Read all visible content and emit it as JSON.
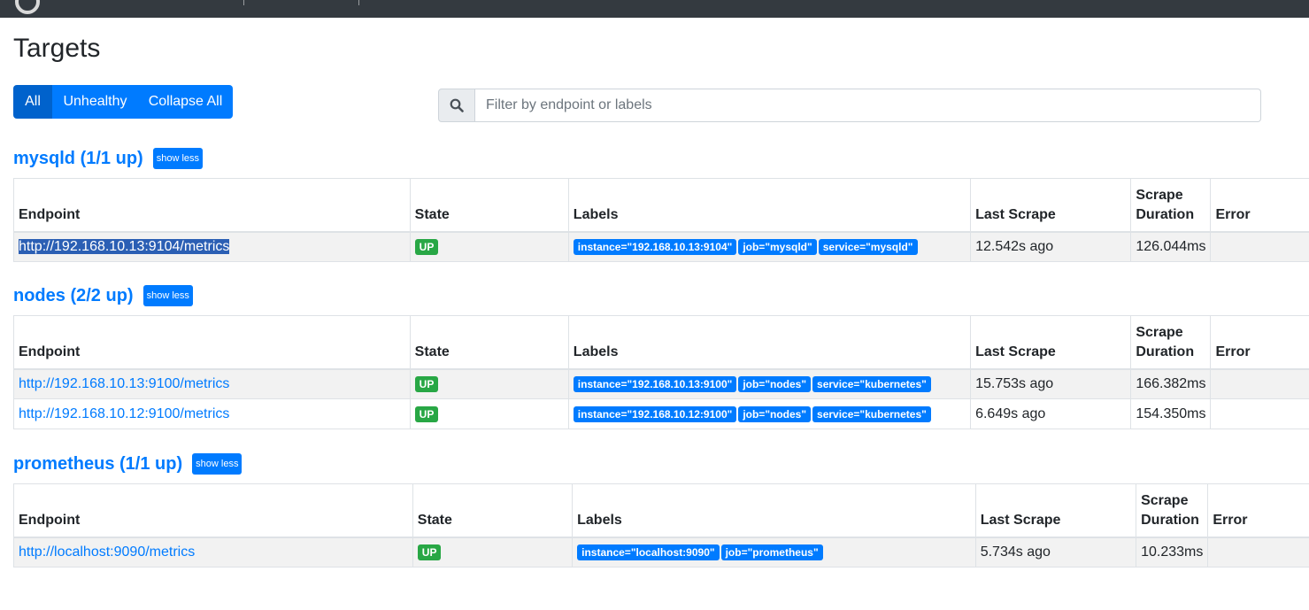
{
  "page_title": "Targets",
  "filter_buttons": [
    {
      "label": "All",
      "active": true
    },
    {
      "label": "Unhealthy",
      "active": false
    },
    {
      "label": "Collapse All",
      "active": false
    }
  ],
  "search": {
    "placeholder": "Filter by endpoint or labels",
    "icon": "search-icon"
  },
  "columns": [
    "Endpoint",
    "State",
    "Labels",
    "Last Scrape",
    "Scrape Duration",
    "Error"
  ],
  "pools": [
    {
      "title": "mysqld (1/1 up)",
      "toggle_label": "show less",
      "targets": [
        {
          "endpoint": "http://192.168.10.13:9104/metrics",
          "state": "UP",
          "labels": [
            "instance=\"192.168.10.13:9104\"",
            "job=\"mysqld\"",
            "service=\"mysqld\""
          ],
          "last_scrape": "12.542s ago",
          "duration": "126.044ms",
          "error": ""
        }
      ]
    },
    {
      "title": "nodes (2/2 up)",
      "toggle_label": "show less",
      "targets": [
        {
          "endpoint": "http://192.168.10.13:9100/metrics",
          "state": "UP",
          "labels": [
            "instance=\"192.168.10.13:9100\"",
            "job=\"nodes\"",
            "service=\"kubernetes\""
          ],
          "last_scrape": "15.753s ago",
          "duration": "166.382ms",
          "error": ""
        },
        {
          "endpoint": "http://192.168.10.12:9100/metrics",
          "state": "UP",
          "labels": [
            "instance=\"192.168.10.12:9100\"",
            "job=\"nodes\"",
            "service=\"kubernetes\""
          ],
          "last_scrape": "6.649s ago",
          "duration": "154.350ms",
          "error": ""
        }
      ]
    },
    {
      "title": "prometheus (1/1 up)",
      "toggle_label": "show less",
      "targets": [
        {
          "endpoint": "http://localhost:9090/metrics",
          "state": "UP",
          "labels": [
            "instance=\"localhost:9090\"",
            "job=\"prometheus\""
          ],
          "last_scrape": "5.734s ago",
          "duration": "10.233ms",
          "error": ""
        }
      ]
    }
  ],
  "colors": {
    "primary": "#007bff",
    "active": "#0062cc",
    "up": "#28a745",
    "navbar": "#343a40"
  }
}
